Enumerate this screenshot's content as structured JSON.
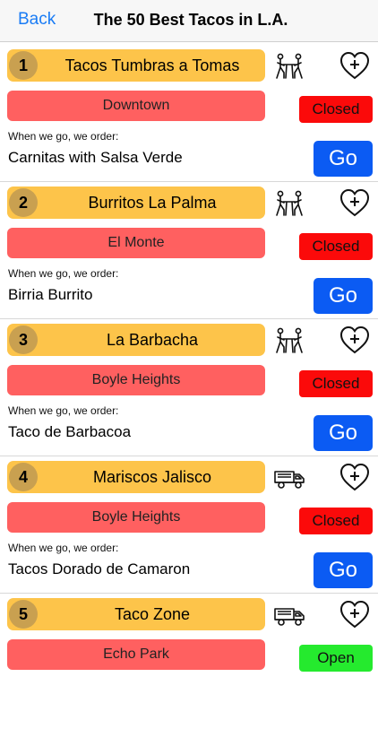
{
  "nav": {
    "back_label": "Back",
    "title": "The 50 Best Tacos in L.A."
  },
  "order_caption": "When we go, we order:",
  "go_label": "Go",
  "entries": [
    {
      "rank": "1",
      "name": "Tacos Tumbras a Tomas",
      "type_icon": "dining-table-icon",
      "neighborhood": "Downtown",
      "status": "Closed",
      "order": "Carnitas with Salsa Verde"
    },
    {
      "rank": "2",
      "name": "Burritos La Palma",
      "type_icon": "dining-table-icon",
      "neighborhood": "El Monte",
      "status": "Closed",
      "order": "Birria Burrito"
    },
    {
      "rank": "3",
      "name": "La Barbacha",
      "type_icon": "dining-table-icon",
      "neighborhood": "Boyle Heights",
      "status": "Closed",
      "order": "Taco de Barbacoa"
    },
    {
      "rank": "4",
      "name": "Mariscos Jalisco",
      "type_icon": "food-truck-icon",
      "neighborhood": "Boyle Heights",
      "status": "Closed",
      "order": "Tacos Dorado de Camaron"
    },
    {
      "rank": "5",
      "name": "Taco Zone",
      "type_icon": "food-truck-icon",
      "neighborhood": "Echo Park",
      "status": "Open",
      "order": ""
    }
  ],
  "colors": {
    "name_bar": "#fdc44a",
    "rank_circle": "#c9a050",
    "neighborhood_button": "#ff6060",
    "status_closed": "#fb0a0a",
    "status_open": "#25ea2e",
    "go_button": "#0b5bf3",
    "back_link": "#1a7cf5"
  }
}
